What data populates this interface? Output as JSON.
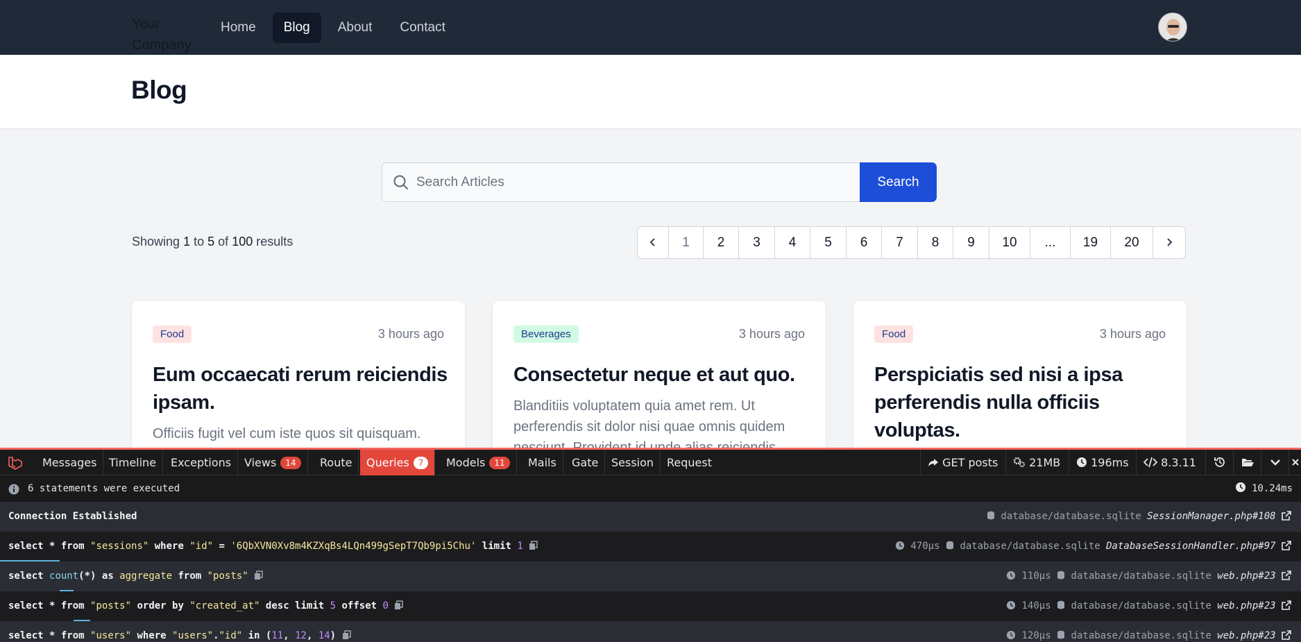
{
  "nav": {
    "brand": "Your Company",
    "links": [
      {
        "label": "Home",
        "active": false
      },
      {
        "label": "Blog",
        "active": true
      },
      {
        "label": "About",
        "active": false
      },
      {
        "label": "Contact",
        "active": false
      }
    ],
    "avatar_icon": "user-avatar"
  },
  "header": {
    "title": "Blog"
  },
  "search": {
    "placeholder": "Search Articles",
    "value": "",
    "button_label": "Search",
    "icon": "search-icon"
  },
  "results": {
    "prefix": "Showing",
    "from": "1",
    "to_word": "to",
    "to": "5",
    "of_word": "of",
    "total": "100",
    "suffix": "results"
  },
  "pagination": {
    "prev_icon": "chevron-left-icon",
    "next_icon": "chevron-right-icon",
    "pages": [
      "1",
      "2",
      "3",
      "4",
      "5",
      "6",
      "7",
      "8",
      "9",
      "10",
      "...",
      "19",
      "20"
    ],
    "current": "1"
  },
  "posts": [
    {
      "category": "Food",
      "tag_bg": "#fee2e2",
      "tag_color": "#1e3a8a",
      "time": "3 hours ago",
      "title": "Eum occaecati rerum reiciendis ipsam.",
      "excerpt": "Officiis fugit vel cum iste quos sit quisquam."
    },
    {
      "category": "Beverages",
      "tag_bg": "#d1fae5",
      "tag_color": "#1e3a8a",
      "time": "3 hours ago",
      "title": "Consectetur neque et aut quo.",
      "excerpt": "Blanditiis voluptatem quia amet rem. Ut perferendis sit dolor nisi quae omnis quidem nesciunt. Provident id unde alias reiciendis."
    },
    {
      "category": "Food",
      "tag_bg": "#fee2e2",
      "tag_color": "#1e3a8a",
      "time": "3 hours ago",
      "title": "Perspiciatis sed nisi a ipsa perferendis nulla officiis voluptas.",
      "excerpt": ""
    }
  ],
  "debugbar": {
    "accent": "#f4645f",
    "tabs": [
      {
        "label": "Messages",
        "badge": null
      },
      {
        "label": "Timeline",
        "badge": null
      },
      {
        "label": "Exceptions",
        "badge": null
      },
      {
        "label": "Views",
        "badge": "14"
      },
      {
        "label": "Route",
        "badge": null
      },
      {
        "label": "Queries",
        "badge": "7",
        "active": true
      },
      {
        "label": "Models",
        "badge": "11"
      },
      {
        "label": "Mails",
        "badge": null
      },
      {
        "label": "Gate",
        "badge": null
      },
      {
        "label": "Session",
        "badge": null
      },
      {
        "label": "Request",
        "badge": null
      }
    ],
    "stats": {
      "route": "GET posts",
      "memory": "21MB",
      "time": "196ms",
      "php_version": "8.3.11"
    },
    "status": {
      "text": "6 statements were executed",
      "total_time": "10.24ms"
    },
    "queries": [
      {
        "sql": "Connection Established",
        "duration": "",
        "connection": "database/database.sqlite",
        "source": "SessionManager.php#108"
      },
      {
        "sql": "select * from \"sessions\" where \"id\" = '6QbXVN0Xv8m4KZXqBs4LQn499gSepT7Qb9pi5Chu' limit 1",
        "duration": "470μs",
        "connection": "database/database.sqlite",
        "source": "DatabaseSessionHandler.php#97"
      },
      {
        "sql": "select count(*) as aggregate from \"posts\"",
        "duration": "110μs",
        "connection": "database/database.sqlite",
        "source": "web.php#23"
      },
      {
        "sql": "select * from \"posts\" order by \"created_at\" desc limit 5 offset 0",
        "duration": "140μs",
        "connection": "database/database.sqlite",
        "source": "web.php#23"
      },
      {
        "sql": "select * from \"users\" where \"users\".\"id\" in (11, 12, 14)",
        "duration": "120μs",
        "connection": "database/database.sqlite",
        "source": "web.php#23"
      }
    ]
  }
}
